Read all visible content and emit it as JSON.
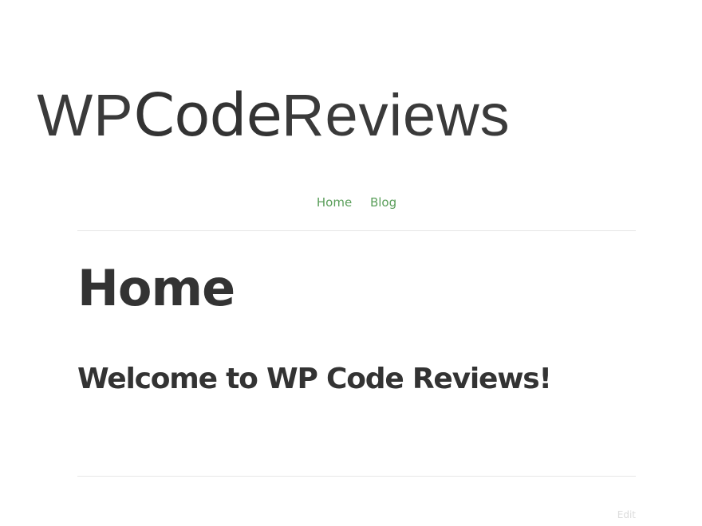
{
  "site": {
    "logo_part_1": "WP",
    "logo_part_2": "Code",
    "logo_part_3": "Reviews"
  },
  "nav": {
    "items": [
      {
        "label": "Home"
      },
      {
        "label": "Blog"
      }
    ]
  },
  "page": {
    "title": "Home",
    "heading": "Welcome to WP Code Reviews!",
    "edit_label": "Edit"
  },
  "colors": {
    "text": "#333333",
    "link": "#5a9e5a",
    "divider": "#e6e6e6",
    "edit": "#dcdcdc"
  }
}
